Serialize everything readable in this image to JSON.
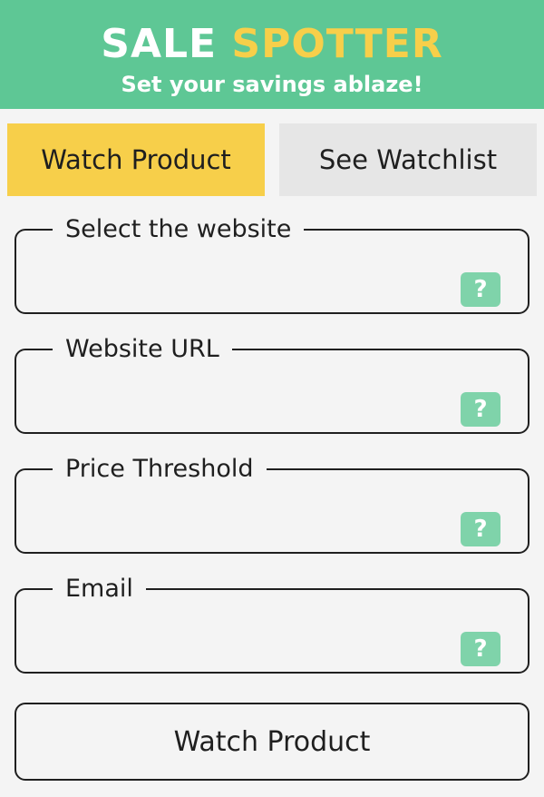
{
  "header": {
    "brand_part1": "SALE",
    "brand_part2": "SPOTTER",
    "tagline": "Set your savings ablaze!",
    "colors": {
      "background": "#5ec795",
      "accent": "#f7cf4a",
      "text": "#ffffff"
    }
  },
  "tabs": [
    {
      "label": "Watch Product",
      "active": true
    },
    {
      "label": "See Watchlist",
      "active": false
    }
  ],
  "form": {
    "fields": [
      {
        "label": "Select the website",
        "value": "",
        "help_icon": "question-mark-icon",
        "help_text": "?"
      },
      {
        "label": "Website URL",
        "value": "",
        "help_icon": "question-mark-icon",
        "help_text": "?"
      },
      {
        "label": "Price Threshold",
        "value": "",
        "help_icon": "question-mark-icon",
        "help_text": "?"
      },
      {
        "label": "Email",
        "value": "",
        "help_icon": "question-mark-icon",
        "help_text": "?"
      }
    ],
    "submit_label": "Watch Product"
  }
}
